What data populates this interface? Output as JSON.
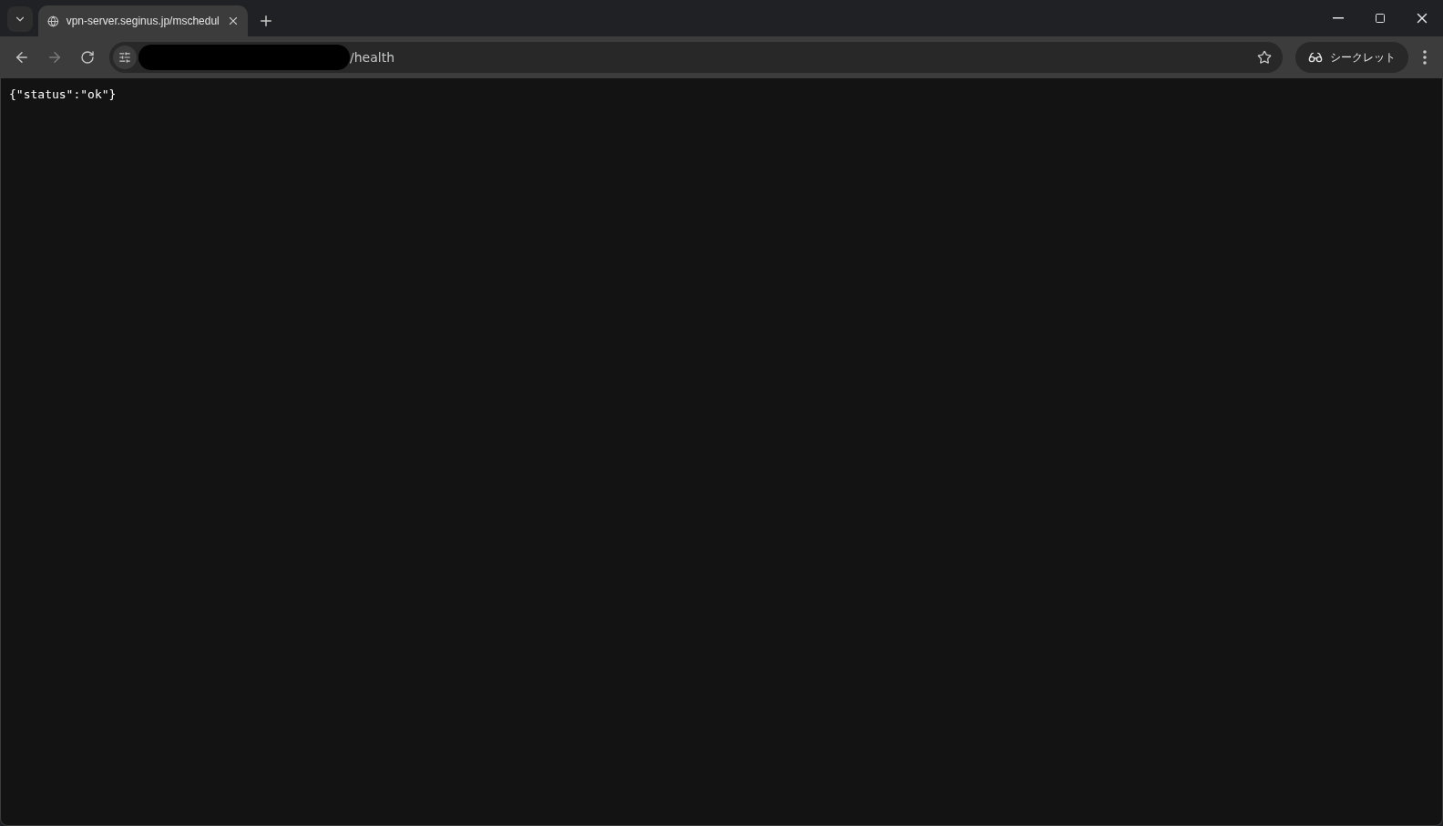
{
  "tab": {
    "title": "vpn-server.seginus.jp/mschedul",
    "selected": true
  },
  "address_bar": {
    "value": "/health",
    "redacted": true
  },
  "profile": {
    "label": "シークレット"
  },
  "page": {
    "body": "{\"status\":\"ok\"}"
  }
}
